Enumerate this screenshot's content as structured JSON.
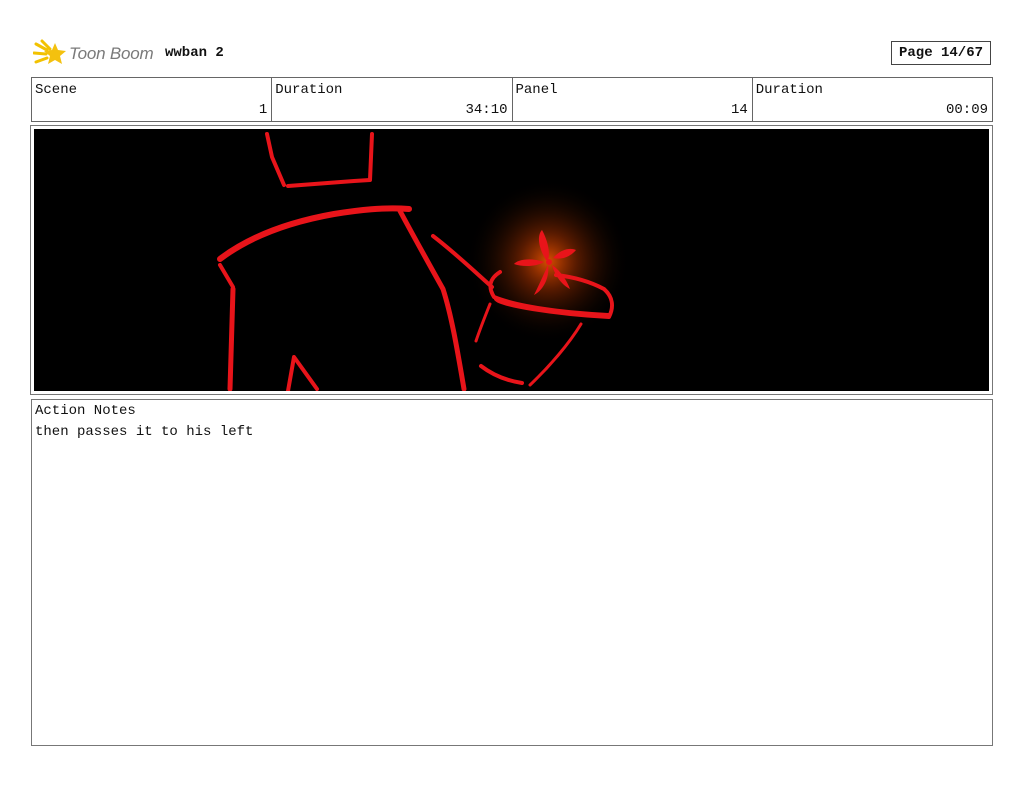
{
  "header": {
    "logo_text": "Toon Boom",
    "project_title": "wwban 2",
    "page": "Page 14/67"
  },
  "info": [
    {
      "label": "Scene",
      "value": "1"
    },
    {
      "label": "Duration",
      "value": "34:10"
    },
    {
      "label": "Panel",
      "value": "14"
    },
    {
      "label": "Duration",
      "value": "00:09"
    }
  ],
  "panel": {
    "background": "#000000",
    "stroke_color": "#e8141a",
    "glow_color": "#ff5a00"
  },
  "notes": {
    "label": "Action Notes",
    "text": "then passes it to his left"
  }
}
